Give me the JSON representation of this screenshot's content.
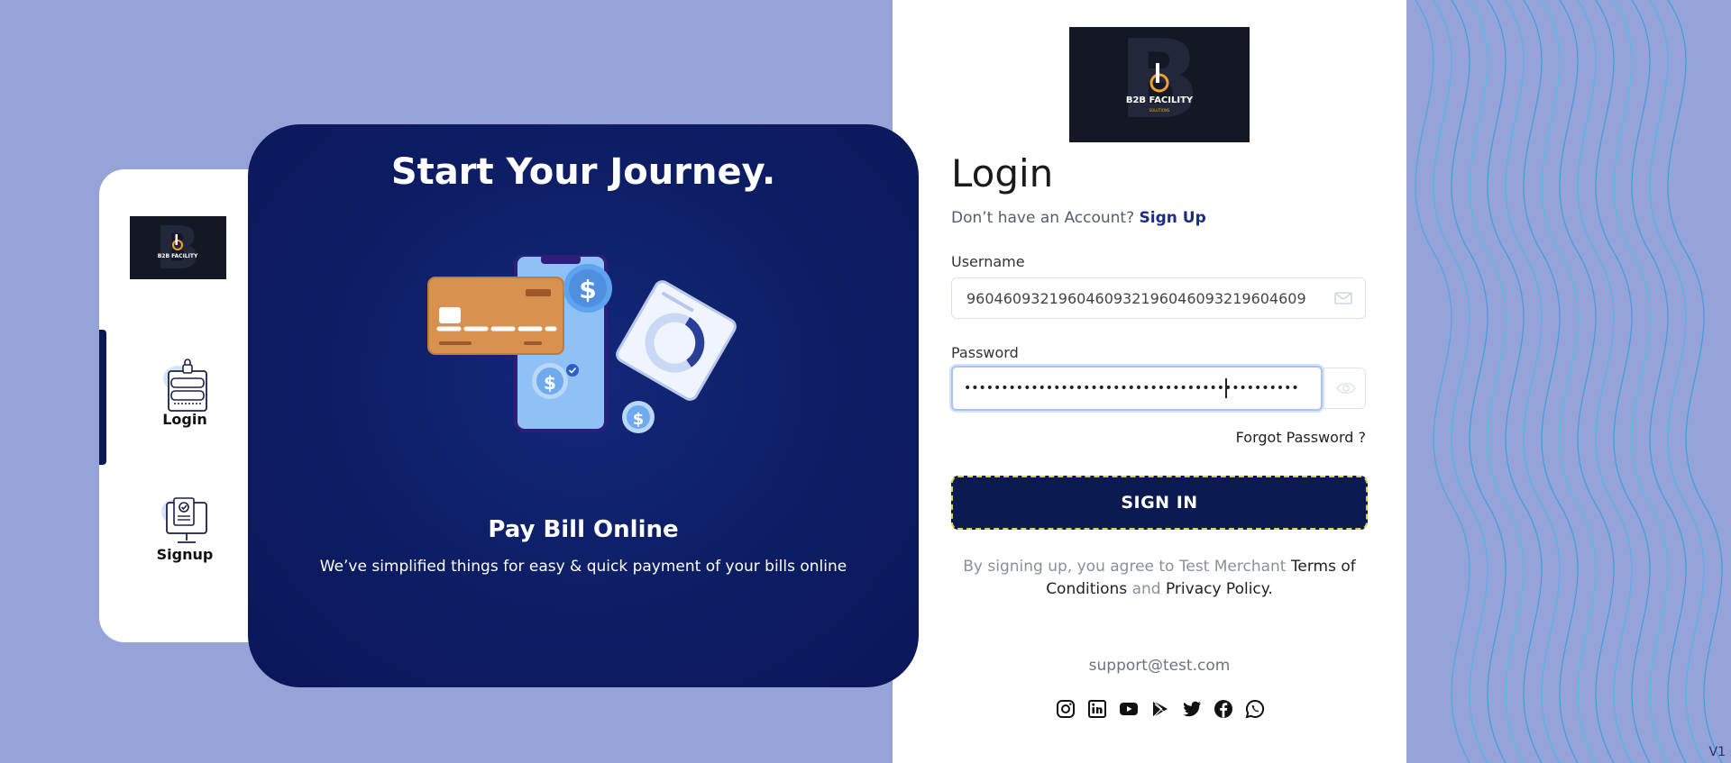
{
  "brand": {
    "logo_text": "B2B FACILITY",
    "logo_subtext": "SOLUTIONS"
  },
  "side_nav": {
    "items": [
      {
        "label": "Login",
        "icon": "login-form-icon"
      },
      {
        "label": "Signup",
        "icon": "signup-monitor-icon"
      }
    ]
  },
  "hero": {
    "title": "Start Your Journey.",
    "subtitle": "Pay Bill Online",
    "description": "We’ve simplified things for easy & quick payment of your bills online"
  },
  "login": {
    "title": "Login",
    "signup_prompt": "Don’t have an Account?",
    "signup_link": "Sign Up",
    "username_label": "Username",
    "username_value": "9604609321960460932196046093219604609",
    "password_label": "Password",
    "password_value": "•••••••••••••••••••••••••••••••••••••••••••••",
    "forgot_link": "Forgot Password ?",
    "signin_button": "SIGN IN",
    "terms_prefix": "By signing up, you agree to Test Merchant",
    "terms_link": "Terms of Conditions",
    "terms_and": "and",
    "privacy_link": "Privacy Policy."
  },
  "footer": {
    "support_email": "support@test.com",
    "social_icons": [
      "instagram-icon",
      "linkedin-icon",
      "youtube-icon",
      "play-store-icon",
      "twitter-icon",
      "facebook-icon",
      "whatsapp-icon"
    ],
    "version": "V1"
  },
  "colors": {
    "background": "#95a3d8",
    "navy": "#0c1a52",
    "link_blue": "#1b2d8a",
    "focus_border": "#a8c4f2",
    "button_outline": "#d8d256"
  }
}
